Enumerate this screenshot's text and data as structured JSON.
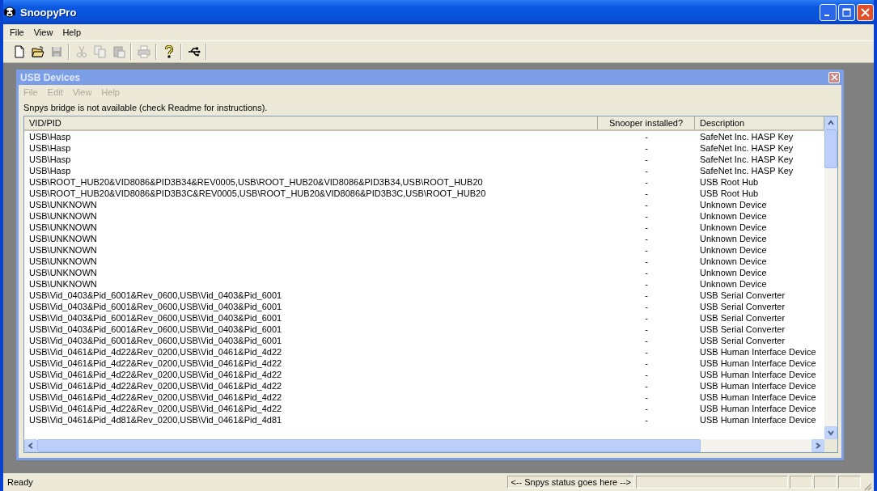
{
  "window": {
    "title": "SnoopyPro"
  },
  "menu": [
    {
      "label": "File",
      "disabled": false
    },
    {
      "label": "View",
      "disabled": false
    },
    {
      "label": "Help",
      "disabled": false
    }
  ],
  "toolbar": [
    {
      "kind": "new",
      "disabled": false
    },
    {
      "kind": "open",
      "disabled": false
    },
    {
      "kind": "save",
      "disabled": true
    },
    {
      "kind": "separator"
    },
    {
      "kind": "cut",
      "disabled": true
    },
    {
      "kind": "copy",
      "disabled": true
    },
    {
      "kind": "paste",
      "disabled": true
    },
    {
      "kind": "separator"
    },
    {
      "kind": "print",
      "disabled": true
    },
    {
      "kind": "separator"
    },
    {
      "kind": "help",
      "disabled": false
    },
    {
      "kind": "separator"
    },
    {
      "kind": "usb",
      "disabled": false
    },
    {
      "kind": "separator"
    }
  ],
  "child_window": {
    "title": "USB Devices",
    "menu": [
      {
        "label": "File",
        "disabled": true
      },
      {
        "label": "Edit",
        "disabled": true
      },
      {
        "label": "View",
        "disabled": true
      },
      {
        "label": "Help",
        "disabled": true
      }
    ],
    "message": "Snpys bridge is not available (check Readme for instructions).",
    "table": {
      "columns": [
        "VID/PID",
        "Snooper installed?",
        "Description"
      ],
      "rows": [
        [
          "USB\\Hasp",
          "-",
          "SafeNet Inc. HASP Key"
        ],
        [
          "USB\\Hasp",
          "-",
          "SafeNet Inc. HASP Key"
        ],
        [
          "USB\\Hasp",
          "-",
          "SafeNet Inc. HASP Key"
        ],
        [
          "USB\\Hasp",
          "-",
          "SafeNet Inc. HASP Key"
        ],
        [
          "USB\\ROOT_HUB20&VID8086&PID3B34&REV0005,USB\\ROOT_HUB20&VID8086&PID3B34,USB\\ROOT_HUB20",
          "-",
          "USB Root Hub"
        ],
        [
          "USB\\ROOT_HUB20&VID8086&PID3B3C&REV0005,USB\\ROOT_HUB20&VID8086&PID3B3C,USB\\ROOT_HUB20",
          "-",
          "USB Root Hub"
        ],
        [
          "USB\\UNKNOWN",
          "-",
          "Unknown Device"
        ],
        [
          "USB\\UNKNOWN",
          "-",
          "Unknown Device"
        ],
        [
          "USB\\UNKNOWN",
          "-",
          "Unknown Device"
        ],
        [
          "USB\\UNKNOWN",
          "-",
          "Unknown Device"
        ],
        [
          "USB\\UNKNOWN",
          "-",
          "Unknown Device"
        ],
        [
          "USB\\UNKNOWN",
          "-",
          "Unknown Device"
        ],
        [
          "USB\\UNKNOWN",
          "-",
          "Unknown Device"
        ],
        [
          "USB\\UNKNOWN",
          "-",
          "Unknown Device"
        ],
        [
          "USB\\Vid_0403&Pid_6001&Rev_0600,USB\\Vid_0403&Pid_6001",
          "-",
          "USB Serial Converter"
        ],
        [
          "USB\\Vid_0403&Pid_6001&Rev_0600,USB\\Vid_0403&Pid_6001",
          "-",
          "USB Serial Converter"
        ],
        [
          "USB\\Vid_0403&Pid_6001&Rev_0600,USB\\Vid_0403&Pid_6001",
          "-",
          "USB Serial Converter"
        ],
        [
          "USB\\Vid_0403&Pid_6001&Rev_0600,USB\\Vid_0403&Pid_6001",
          "-",
          "USB Serial Converter"
        ],
        [
          "USB\\Vid_0403&Pid_6001&Rev_0600,USB\\Vid_0403&Pid_6001",
          "-",
          "USB Serial Converter"
        ],
        [
          "USB\\Vid_0461&Pid_4d22&Rev_0200,USB\\Vid_0461&Pid_4d22",
          "-",
          "USB Human Interface Device"
        ],
        [
          "USB\\Vid_0461&Pid_4d22&Rev_0200,USB\\Vid_0461&Pid_4d22",
          "-",
          "USB Human Interface Device"
        ],
        [
          "USB\\Vid_0461&Pid_4d22&Rev_0200,USB\\Vid_0461&Pid_4d22",
          "-",
          "USB Human Interface Device"
        ],
        [
          "USB\\Vid_0461&Pid_4d22&Rev_0200,USB\\Vid_0461&Pid_4d22",
          "-",
          "USB Human Interface Device"
        ],
        [
          "USB\\Vid_0461&Pid_4d22&Rev_0200,USB\\Vid_0461&Pid_4d22",
          "-",
          "USB Human Interface Device"
        ],
        [
          "USB\\Vid_0461&Pid_4d22&Rev_0200,USB\\Vid_0461&Pid_4d22",
          "-",
          "USB Human Interface Device"
        ],
        [
          "USB\\Vid_0461&Pid_4d81&Rev_0200,USB\\Vid_0461&Pid_4d81",
          "-",
          "USB Human Interface Device"
        ]
      ]
    }
  },
  "status_bar": {
    "panes": [
      "Ready",
      "<-- Snpys status goes here -->"
    ]
  }
}
